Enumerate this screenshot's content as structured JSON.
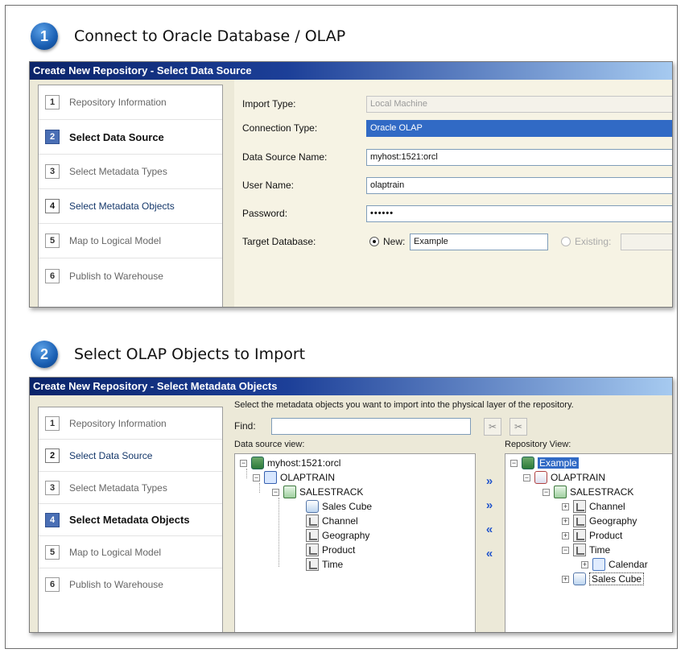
{
  "section1": {
    "badge": "1",
    "title": "Connect to Oracle Database / OLAP",
    "dialog_title": "Create New Repository - Select Data Source",
    "steps": [
      {
        "num": "1",
        "label": "Repository Information"
      },
      {
        "num": "2",
        "label": "Select Data Source"
      },
      {
        "num": "3",
        "label": "Select Metadata Types"
      },
      {
        "num": "4",
        "label": "Select Metadata Objects"
      },
      {
        "num": "5",
        "label": "Map to Logical Model"
      },
      {
        "num": "6",
        "label": "Publish to Warehouse"
      }
    ],
    "form": {
      "import_type_label": "Import Type:",
      "import_type_value": "Local Machine",
      "connection_type_label": "Connection Type:",
      "connection_type_value": "Oracle OLAP",
      "dsn_label": "Data Source Name:",
      "dsn_value": "myhost:1521:orcl",
      "user_label": "User Name:",
      "user_value": "olaptrain",
      "password_label": "Password:",
      "password_value": "••••••",
      "target_label": "Target Database:",
      "new_label": "New:",
      "new_value": "Example",
      "existing_label": "Existing:"
    }
  },
  "section2": {
    "badge": "2",
    "title": "Select OLAP Objects to Import",
    "dialog_title": "Create New Repository - Select Metadata Objects",
    "steps": [
      {
        "num": "1",
        "label": "Repository Information"
      },
      {
        "num": "2",
        "label": "Select Data Source"
      },
      {
        "num": "3",
        "label": "Select Metadata Types"
      },
      {
        "num": "4",
        "label": "Select Metadata Objects"
      },
      {
        "num": "5",
        "label": "Map to Logical Model"
      },
      {
        "num": "6",
        "label": "Publish to Warehouse"
      }
    ],
    "instruction": "Select the metadata objects you want to import into the physical layer of the repository.",
    "find_label": "Find:",
    "find_value": "",
    "data_source_view_label": "Data source view:",
    "repository_view_label": "Repository View:",
    "source_tree": {
      "root": "myhost:1521:orcl",
      "schema": "OLAPTRAIN",
      "catalog": "SALESTRACK",
      "items": [
        "Sales Cube",
        "Channel",
        "Geography",
        "Product",
        "Time"
      ]
    },
    "repo_tree": {
      "root": "Example",
      "schema": "OLAPTRAIN",
      "catalog": "SALESTRACK",
      "items": [
        "Channel",
        "Geography",
        "Product",
        "Time"
      ],
      "time_child": "Calendar",
      "last": "Sales Cube"
    },
    "buttons": {
      "add": "»",
      "add_all": "»",
      "remove": "«",
      "remove_all": "«"
    }
  }
}
